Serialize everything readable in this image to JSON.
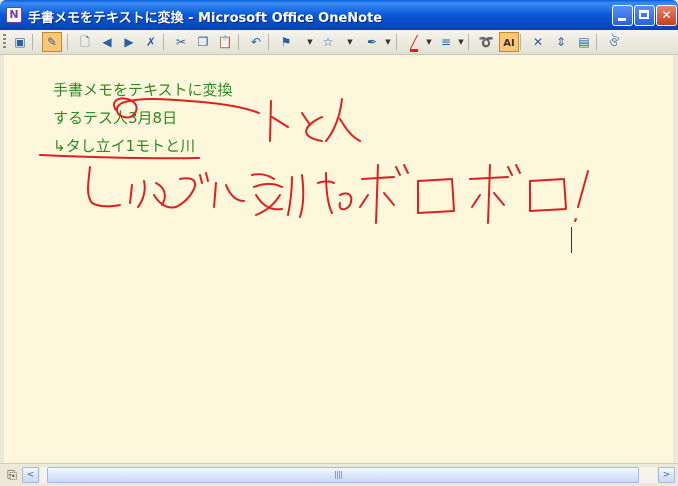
{
  "window": {
    "title": "手書メモをテキストに変換 - Microsoft Office OneNote",
    "app_icon_letter": "N"
  },
  "toolbar": {
    "tools": [
      {
        "name": "full-page-view-icon",
        "glyph": "▣"
      },
      {
        "name": "pen-icon",
        "glyph": "✎",
        "active": true
      },
      {
        "name": "new-page-icon",
        "glyph": "🗋"
      },
      {
        "name": "back-icon",
        "glyph": "◀"
      },
      {
        "name": "forward-icon",
        "glyph": "▶"
      },
      {
        "name": "delete-page-icon",
        "glyph": "✗"
      },
      {
        "name": "cut-icon",
        "glyph": "✂"
      },
      {
        "name": "copy-icon",
        "glyph": "❐"
      },
      {
        "name": "paste-icon",
        "glyph": "📋"
      },
      {
        "name": "undo-icon",
        "glyph": "↶"
      },
      {
        "name": "flag-icon",
        "glyph": "⚑"
      },
      {
        "name": "star-icon",
        "glyph": "☆"
      },
      {
        "name": "pen-style-icon",
        "glyph": "✒"
      },
      {
        "name": "pen-color-icon",
        "glyph": "╱"
      },
      {
        "name": "line-weight-icon",
        "glyph": "≡"
      },
      {
        "name": "lasso-select-icon",
        "glyph": "➰"
      },
      {
        "name": "ink-to-text-icon",
        "glyph": "AI",
        "active": true
      },
      {
        "name": "eraser-icon",
        "glyph": "✕"
      },
      {
        "name": "insert-space-icon",
        "glyph": "⇕"
      },
      {
        "name": "page-list-icon",
        "glyph": "▤"
      },
      {
        "name": "research-icon",
        "glyph": "ঔ"
      }
    ]
  },
  "page": {
    "lines": [
      "手書メモをテキストに変換",
      "するテス人3月8日",
      "↳タし立イ1モトと川"
    ]
  },
  "scrollbar": {
    "left_arrow": "<",
    "right_arrow": ">"
  },
  "colors": {
    "typed_text": "#2d8a22",
    "ink": "#e02020",
    "page_bg": "#fdf7db"
  }
}
